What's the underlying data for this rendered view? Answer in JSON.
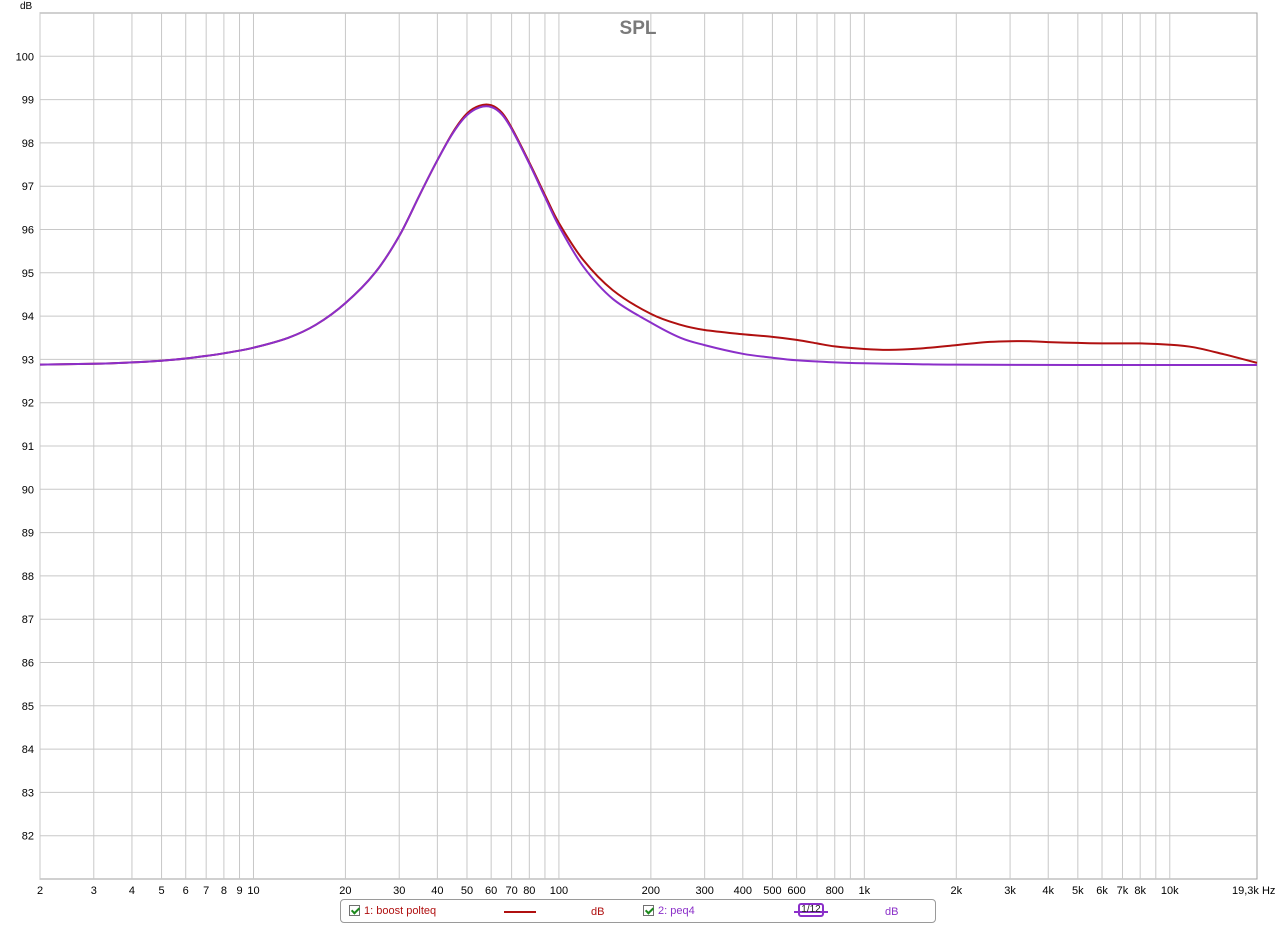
{
  "chart_data": {
    "type": "line",
    "title": "SPL",
    "ylabel": "dB",
    "xlabel_unit": "Hz",
    "x_scale": "log",
    "xlim": [
      2,
      19300
    ],
    "ylim": [
      81,
      101
    ],
    "grid": true,
    "y_ticks": [
      82,
      83,
      84,
      85,
      86,
      87,
      88,
      89,
      90,
      91,
      92,
      93,
      94,
      95,
      96,
      97,
      98,
      99,
      100
    ],
    "x_ticks": [
      {
        "v": 2,
        "label": "2"
      },
      {
        "v": 3,
        "label": "3"
      },
      {
        "v": 4,
        "label": "4"
      },
      {
        "v": 5,
        "label": "5"
      },
      {
        "v": 6,
        "label": "6"
      },
      {
        "v": 7,
        "label": "7"
      },
      {
        "v": 8,
        "label": "8"
      },
      {
        "v": 9,
        "label": "9"
      },
      {
        "v": 10,
        "label": "10"
      },
      {
        "v": 20,
        "label": "20"
      },
      {
        "v": 30,
        "label": "30"
      },
      {
        "v": 40,
        "label": "40"
      },
      {
        "v": 50,
        "label": "50"
      },
      {
        "v": 60,
        "label": "60"
      },
      {
        "v": 70,
        "label": "70"
      },
      {
        "v": 80,
        "label": "80"
      },
      {
        "v": 100,
        "label": "100"
      },
      {
        "v": 200,
        "label": "200"
      },
      {
        "v": 300,
        "label": "300"
      },
      {
        "v": 400,
        "label": "400"
      },
      {
        "v": 500,
        "label": "500"
      },
      {
        "v": 600,
        "label": "600"
      },
      {
        "v": 800,
        "label": "800"
      },
      {
        "v": 1000,
        "label": "1k"
      },
      {
        "v": 2000,
        "label": "2k"
      },
      {
        "v": 3000,
        "label": "3k"
      },
      {
        "v": 4000,
        "label": "4k"
      },
      {
        "v": 5000,
        "label": "5k"
      },
      {
        "v": 6000,
        "label": "6k"
      },
      {
        "v": 7000,
        "label": "7k"
      },
      {
        "v": 8000,
        "label": "8k"
      },
      {
        "v": 10000,
        "label": "10k"
      },
      {
        "v": 19300,
        "label": "19,3k Hz"
      }
    ],
    "series": [
      {
        "name": "1: boost polteq",
        "color": "#b01010",
        "points": [
          [
            2,
            92.88
          ],
          [
            3,
            92.9
          ],
          [
            4,
            92.93
          ],
          [
            5,
            92.97
          ],
          [
            6,
            93.02
          ],
          [
            7,
            93.08
          ],
          [
            8,
            93.14
          ],
          [
            10,
            93.27
          ],
          [
            13,
            93.5
          ],
          [
            16,
            93.8
          ],
          [
            20,
            94.3
          ],
          [
            25,
            95.0
          ],
          [
            30,
            95.85
          ],
          [
            35,
            96.8
          ],
          [
            40,
            97.6
          ],
          [
            45,
            98.25
          ],
          [
            50,
            98.68
          ],
          [
            55,
            98.86
          ],
          [
            60,
            98.87
          ],
          [
            65,
            98.7
          ],
          [
            70,
            98.35
          ],
          [
            80,
            97.55
          ],
          [
            90,
            96.8
          ],
          [
            100,
            96.15
          ],
          [
            120,
            95.3
          ],
          [
            150,
            94.6
          ],
          [
            200,
            94.05
          ],
          [
            250,
            93.8
          ],
          [
            300,
            93.68
          ],
          [
            400,
            93.58
          ],
          [
            500,
            93.52
          ],
          [
            600,
            93.45
          ],
          [
            700,
            93.37
          ],
          [
            800,
            93.3
          ],
          [
            1000,
            93.24
          ],
          [
            1200,
            93.22
          ],
          [
            1500,
            93.25
          ],
          [
            2000,
            93.33
          ],
          [
            2500,
            93.4
          ],
          [
            3000,
            93.42
          ],
          [
            3500,
            93.42
          ],
          [
            4000,
            93.4
          ],
          [
            5000,
            93.38
          ],
          [
            6000,
            93.37
          ],
          [
            8000,
            93.37
          ],
          [
            10000,
            93.34
          ],
          [
            12000,
            93.28
          ],
          [
            15000,
            93.12
          ],
          [
            19300,
            92.92
          ]
        ]
      },
      {
        "name": "2: peq4",
        "color": "#8b2fc9",
        "points": [
          [
            2,
            92.88
          ],
          [
            3,
            92.9
          ],
          [
            4,
            92.93
          ],
          [
            5,
            92.97
          ],
          [
            6,
            93.02
          ],
          [
            7,
            93.08
          ],
          [
            8,
            93.14
          ],
          [
            10,
            93.27
          ],
          [
            13,
            93.5
          ],
          [
            16,
            93.8
          ],
          [
            20,
            94.3
          ],
          [
            25,
            95.0
          ],
          [
            30,
            95.85
          ],
          [
            35,
            96.8
          ],
          [
            40,
            97.6
          ],
          [
            45,
            98.23
          ],
          [
            50,
            98.64
          ],
          [
            55,
            98.82
          ],
          [
            60,
            98.83
          ],
          [
            65,
            98.66
          ],
          [
            70,
            98.32
          ],
          [
            80,
            97.52
          ],
          [
            90,
            96.75
          ],
          [
            100,
            96.08
          ],
          [
            120,
            95.15
          ],
          [
            150,
            94.4
          ],
          [
            200,
            93.85
          ],
          [
            250,
            93.5
          ],
          [
            300,
            93.33
          ],
          [
            400,
            93.13
          ],
          [
            500,
            93.04
          ],
          [
            600,
            92.98
          ],
          [
            800,
            92.93
          ],
          [
            1000,
            92.91
          ],
          [
            1500,
            92.89
          ],
          [
            2000,
            92.88
          ],
          [
            5000,
            92.87
          ],
          [
            10000,
            92.87
          ],
          [
            19300,
            92.87
          ]
        ]
      }
    ]
  },
  "legend": {
    "items": [
      {
        "label": "1: boost polteq",
        "color": "#b01010",
        "unit": "dB"
      },
      {
        "label": "2: peq4",
        "color": "#8b2fc9",
        "unit": "dB"
      }
    ],
    "smoothing_label": "1/12"
  }
}
